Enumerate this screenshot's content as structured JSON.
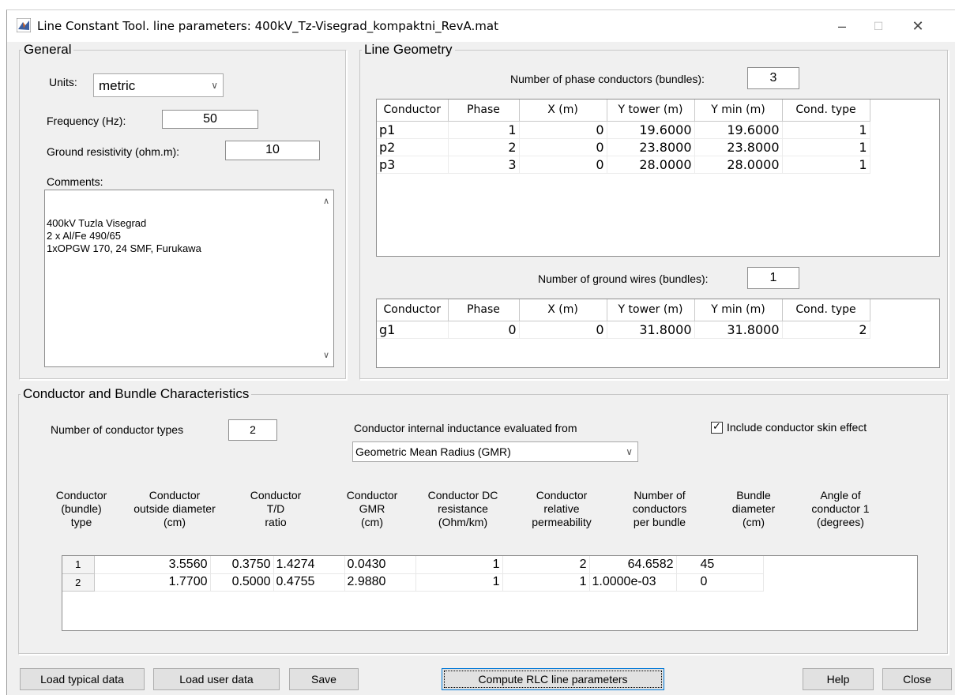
{
  "window": {
    "title": "Line Constant Tool.  line parameters: 400kV_Tz-Visegrad_kompaktni_RevA.mat",
    "minimize": "–",
    "maximize": "☐",
    "close": "✕"
  },
  "general": {
    "title": "General",
    "units_label": "Units:",
    "units_value": "metric",
    "frequency_label": "Frequency (Hz):",
    "frequency_value": "50",
    "ground_label": "Ground resistivity (ohm.m):",
    "ground_value": "10",
    "comments_label": "Comments:",
    "comments_text": "400kV Tuzla Visegrad\n2 x Al/Fe 490/65\n1xOPGW 170, 24 SMF, Furukawa"
  },
  "geometry": {
    "title": "Line Geometry",
    "phase_count_label": "Number of phase conductors (bundles):",
    "phase_count": "3",
    "ground_count_label": "Number of ground wires (bundles):",
    "ground_count": "1",
    "headers": [
      "Conductor",
      "Phase",
      "X (m)",
      "Y tower (m)",
      "Y min (m)",
      "Cond. type"
    ],
    "phase_rows": [
      [
        "p1",
        "1",
        "0",
        "19.6000",
        "19.6000",
        "1"
      ],
      [
        "p2",
        "2",
        "0",
        "23.8000",
        "23.8000",
        "1"
      ],
      [
        "p3",
        "3",
        "0",
        "28.0000",
        "28.0000",
        "1"
      ]
    ],
    "ground_rows": [
      [
        "g1",
        "0",
        "0",
        "31.8000",
        "31.8000",
        "2"
      ]
    ]
  },
  "bundle": {
    "title": "Conductor and Bundle Characteristics",
    "types_label": "Number of conductor types",
    "types_value": "2",
    "inductance_label": "Conductor internal inductance evaluated from",
    "inductance_value": "Geometric Mean Radius (GMR)",
    "skin_label": "Include conductor skin effect",
    "skin_checked": true,
    "col_headers": [
      "Conductor\n(bundle)\ntype",
      "Conductor\noutside diameter\n(cm)",
      "Conductor\nT/D\nratio",
      "Conductor\nGMR\n(cm)",
      "Conductor DC\nresistance\n(Ohm/km)",
      "Conductor\nrelative\npermeability",
      "Number of\nconductors\nper bundle",
      "Bundle\ndiameter\n(cm)",
      "Angle of\nconductor 1\n(degrees)"
    ],
    "rows": [
      [
        "1",
        "3.5560",
        "0.3750",
        "1.4274",
        "0.0430",
        "1",
        "2",
        "64.6582",
        "45"
      ],
      [
        "2",
        "1.7700",
        "0.5000",
        "0.4755",
        "2.9880",
        "1",
        "1",
        "1.0000e-03",
        "0"
      ]
    ]
  },
  "buttons": {
    "load_typical": "Load typical data",
    "load_user": "Load user data",
    "save": "Save",
    "compute": "Compute RLC line parameters",
    "help": "Help",
    "close": "Close"
  },
  "icons": {
    "app": "matlab-icon",
    "dropdown": "chevron-down-icon",
    "scroll_up": "scroll-up-icon",
    "scroll_down": "scroll-down-icon",
    "check": "checkmark-icon"
  }
}
